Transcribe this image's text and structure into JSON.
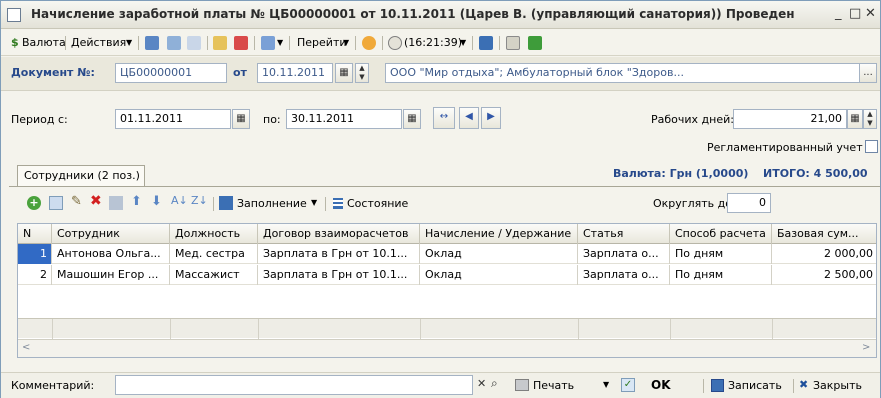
{
  "window": {
    "title": "Начисление заработной платы № ЦБ00000001 от 10.11.2011 (Царев В. (управляющий санатория)) Проведен",
    "minimize": "_",
    "maximize": "□",
    "close": "✕"
  },
  "toolbar": {
    "currency_label": "Валюта",
    "actions_label": "Действия",
    "time_label": "(16:21:39)",
    "goto_label": "Перейти"
  },
  "doc": {
    "number_label": "Документ №:",
    "number_value": "ЦБ00000001",
    "date_label": "от",
    "date_value": "10.11.2011",
    "org_value": "ООО \"Мир отдыха\"; Амбулаторный блок \"Здоров...",
    "more": "..."
  },
  "period": {
    "from_label": "Период с:",
    "from_value": "01.11.2011",
    "to_label": "по:",
    "to_value": "30.11.2011",
    "workdays_label": "Рабочих дней:",
    "workdays_value": "21,00",
    "regulated_label": "Регламентированный учет"
  },
  "summary": {
    "currency_info": "Валюта: Грн (1,0000)",
    "total": "ИТОГО: 4 500,00"
  },
  "tab": {
    "label": "Сотрудники (2 поз.)"
  },
  "table_toolbar": {
    "fill_label": "Заполнение",
    "state_label": "Состояние",
    "round_label": "Округлять до:",
    "round_value": "0"
  },
  "table": {
    "columns": [
      "N",
      "Сотрудник",
      "Должность",
      "Договор взаиморасчетов",
      "Начисление / Удержание",
      "Статья",
      "Способ расчета",
      "Базовая сум..."
    ],
    "rows": [
      [
        "1",
        "Антонова Ольга...",
        "Мед. сестра",
        "Зарплата в Грн от 10.1...",
        "Оклад",
        "Зарплата о...",
        "По дням",
        "2 000,00"
      ],
      [
        "2",
        "Машошин Егор ...",
        "Массажист",
        "Зарплата в Грн от 10.1...",
        "Оклад",
        "Зарплата о...",
        "По дням",
        "2 500,00"
      ]
    ]
  },
  "footer": {
    "comment_label": "Комментарий:",
    "comment_value": "",
    "print_label": "Печать",
    "ok_label": "OK",
    "save_label": "Записать",
    "close_label": "Закрыть"
  },
  "colors": {
    "accent_blue": "#27498b",
    "selection": "#316ac5"
  }
}
